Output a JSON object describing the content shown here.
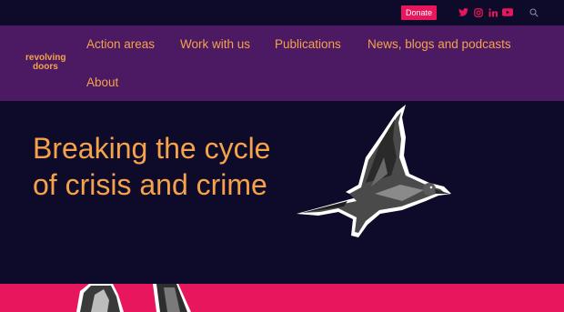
{
  "topbar": {
    "donate_label": "Donate",
    "social_icons": [
      "twitter-icon",
      "instagram-icon",
      "linkedin-icon",
      "youtube-icon"
    ],
    "search_icon": "search-icon"
  },
  "brand": {
    "logo_line1": "revolving",
    "logo_line2": "doors"
  },
  "nav": {
    "items": [
      {
        "label": "Action areas"
      },
      {
        "label": "Work with us"
      },
      {
        "label": "Publications"
      },
      {
        "label": "News, blogs and podcasts"
      },
      {
        "label": "About"
      }
    ]
  },
  "hero": {
    "headline_line1": "Breaking the cycle",
    "headline_line2": "of crisis and crime"
  },
  "colors": {
    "background": "#0e0b2a",
    "nav_background": "#4b1a63",
    "accent_orange": "#f6a24a",
    "accent_pink": "#e8175d"
  }
}
